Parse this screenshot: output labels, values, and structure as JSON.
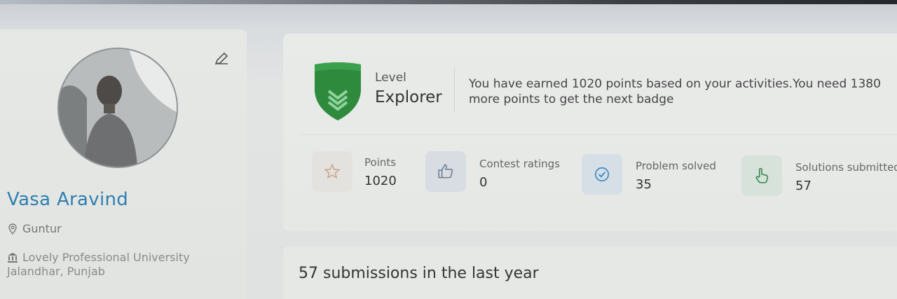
{
  "profile": {
    "name": "Vasa Aravind",
    "location": "Guntur",
    "university_line1": "Lovely Professional University",
    "university_line2": "Jalandhar, Punjab",
    "edit_icon": "edit-icon"
  },
  "level": {
    "label": "Level",
    "name": "Explorer",
    "message": "You have earned 1020 points based on your activities.You need 1380 more points to get the next badge",
    "badge_color": "#2e8b3e"
  },
  "stats": [
    {
      "label": "Points",
      "value": "1020",
      "icon": "star-icon",
      "box_color": "#e4e2df",
      "icon_color": "#c9a58a"
    },
    {
      "label": "Contest ratings",
      "value": "0",
      "icon": "thumbs-up-icon",
      "box_color": "#d8dde3",
      "icon_color": "#6a7a8c"
    },
    {
      "label": "Problem solved",
      "value": "35",
      "icon": "check-circle-icon",
      "box_color": "#d6dfe6",
      "icon_color": "#3f8fc4"
    },
    {
      "label": "Solutions submitted",
      "value": "57",
      "icon": "hand-pointer-icon",
      "box_color": "#d7e3da",
      "icon_color": "#3c8a55"
    }
  ],
  "activity": {
    "title": "57 submissions in the last year"
  }
}
